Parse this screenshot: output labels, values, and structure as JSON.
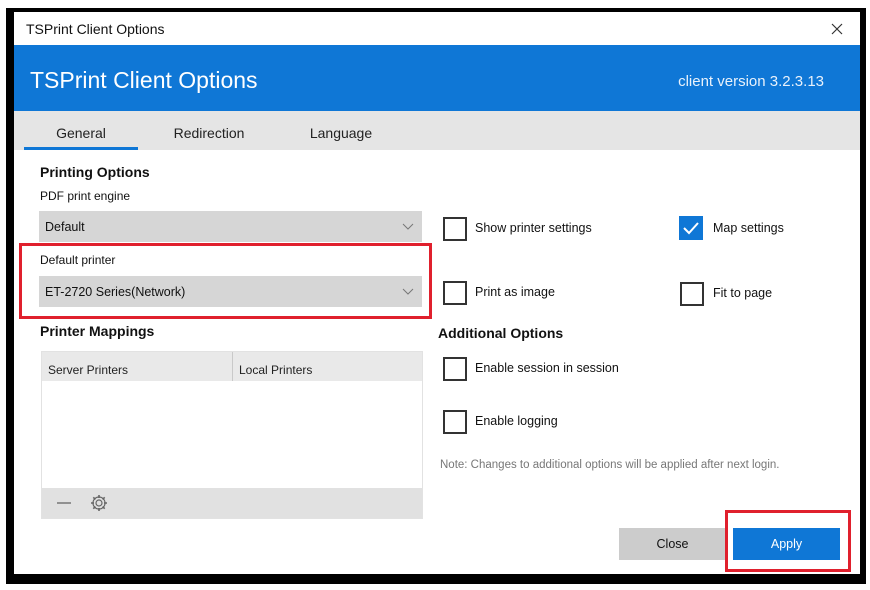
{
  "window": {
    "title": "TSPrint Client Options",
    "heading": "TSPrint Client Options",
    "version": "client version 3.2.3.13"
  },
  "tabs": [
    {
      "label": "General",
      "active": true
    },
    {
      "label": "Redirection",
      "active": false
    },
    {
      "label": "Language",
      "active": false
    }
  ],
  "printing_options": {
    "heading": "Printing Options",
    "pdf_engine_label": "PDF print engine",
    "pdf_engine_value": "Default",
    "default_printer_label": "Default printer",
    "default_printer_value": "ET-2720 Series(Network)"
  },
  "checkboxes": {
    "show_printer_settings": {
      "label": "Show printer settings",
      "checked": false
    },
    "map_settings": {
      "label": "Map settings",
      "checked": true
    },
    "print_as_image": {
      "label": "Print as image",
      "checked": false
    },
    "fit_to_page": {
      "label": "Fit to page",
      "checked": false
    }
  },
  "printer_mappings": {
    "heading": "Printer Mappings",
    "columns": [
      "Server Printers",
      "Local Printers"
    ]
  },
  "additional_options": {
    "heading": "Additional Options",
    "enable_session": {
      "label": "Enable session in session",
      "checked": false
    },
    "enable_logging": {
      "label": "Enable logging",
      "checked": false
    },
    "note": "Note: Changes to additional options will be applied after next login."
  },
  "buttons": {
    "close": "Close",
    "apply": "Apply"
  },
  "colors": {
    "accent": "#0f77d6",
    "highlight": "#e0202d"
  }
}
